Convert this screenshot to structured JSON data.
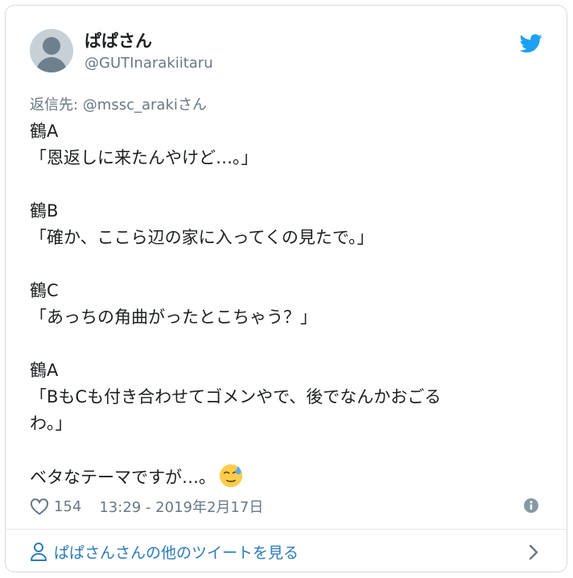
{
  "author": {
    "display_name": "ぱぱさん",
    "handle": "@GUTInarakiitaru"
  },
  "reply": {
    "prefix": "返信先: ",
    "mention": "@mssc_araki",
    "suffix": "さん"
  },
  "tweet": {
    "lines": [
      "鶴A",
      "「恩返しに来たんやけど…。」",
      "",
      "鶴B",
      "「確か、ここら辺の家に入ってくの見たで。」",
      "",
      "鶴C",
      "「あっちの角曲がったとこちゃう？」",
      "",
      "鶴A",
      "「BもCも付き合わせてゴメンやで、後でなんかおごる",
      "わ。」",
      "",
      "ベタなテーマですが…。"
    ],
    "emoji": "sweat-face-emoji"
  },
  "meta": {
    "likes": "154",
    "timestamp": "13:29 - 2019年2月17日"
  },
  "footer": {
    "more_link": "ぱぱさんさんの他のツイートを見る"
  },
  "colors": {
    "brand": "#1da1f2",
    "link": "#2b7bb9",
    "muted": "#697882",
    "text": "#1c2022"
  },
  "icons": [
    "twitter-bird-icon",
    "heart-icon",
    "info-icon",
    "person-icon",
    "chevron-right-icon"
  ]
}
